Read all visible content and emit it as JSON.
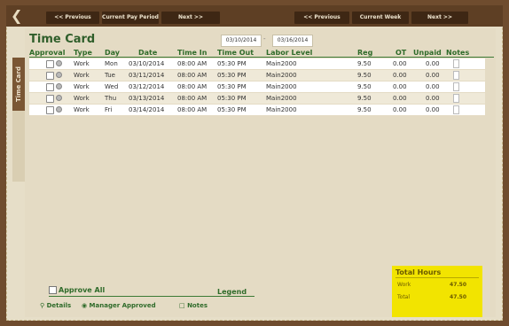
{
  "nav": {
    "pay_prev": "<< Previous",
    "pay_current": "Current Pay Period",
    "pay_next": "Next >>",
    "week_prev": "<< Previous",
    "week_current": "Current Week",
    "week_next": "Next >>"
  },
  "side_tab": "Time Card",
  "title": "Time Card",
  "date_from": "03/10/2014",
  "date_sep": "-",
  "date_to": "03/16/2014",
  "columns": [
    "Approval",
    "Type",
    "Day",
    "Date",
    "Time In",
    "Time Out",
    "Labor Level",
    "Reg",
    "OT",
    "Unpaid",
    "Notes"
  ],
  "rows": [
    {
      "type": "Work",
      "day": "Mon",
      "date": "03/10/2014",
      "time_in": "08:00 AM",
      "time_out": "05:30 PM",
      "labor": "Main2000",
      "reg": "9.50",
      "ot": "0.00",
      "unpaid": "0.00"
    },
    {
      "type": "Work",
      "day": "Tue",
      "date": "03/11/2014",
      "time_in": "08:00 AM",
      "time_out": "05:30 PM",
      "labor": "Main2000",
      "reg": "9.50",
      "ot": "0.00",
      "unpaid": "0.00"
    },
    {
      "type": "Work",
      "day": "Wed",
      "date": "03/12/2014",
      "time_in": "08:00 AM",
      "time_out": "05:30 PM",
      "labor": "Main2000",
      "reg": "9.50",
      "ot": "0.00",
      "unpaid": "0.00"
    },
    {
      "type": "Work",
      "day": "Thu",
      "date": "03/13/2014",
      "time_in": "08:00 AM",
      "time_out": "05:30 PM",
      "labor": "Main2000",
      "reg": "9.50",
      "ot": "0.00",
      "unpaid": "0.00"
    },
    {
      "type": "Work",
      "day": "Fri",
      "date": "03/14/2014",
      "time_in": "08:00 AM",
      "time_out": "05:30 PM",
      "labor": "Main2000",
      "reg": "9.50",
      "ot": "0.00",
      "unpaid": "0.00"
    }
  ],
  "footer": {
    "approve_all": "Approve All",
    "legend": "Legend",
    "details": "Details",
    "manager_approved": "Manager Approved",
    "notes": "Notes"
  },
  "totals": {
    "title": "Total Hours",
    "work_label": "Work",
    "work_value": "47.50",
    "total_label": "Total",
    "total_value": "47.50"
  },
  "colors": {
    "frame": "#6f4c2e",
    "accent_green": "#2f6b2a",
    "totals_bg": "#f2e400"
  }
}
